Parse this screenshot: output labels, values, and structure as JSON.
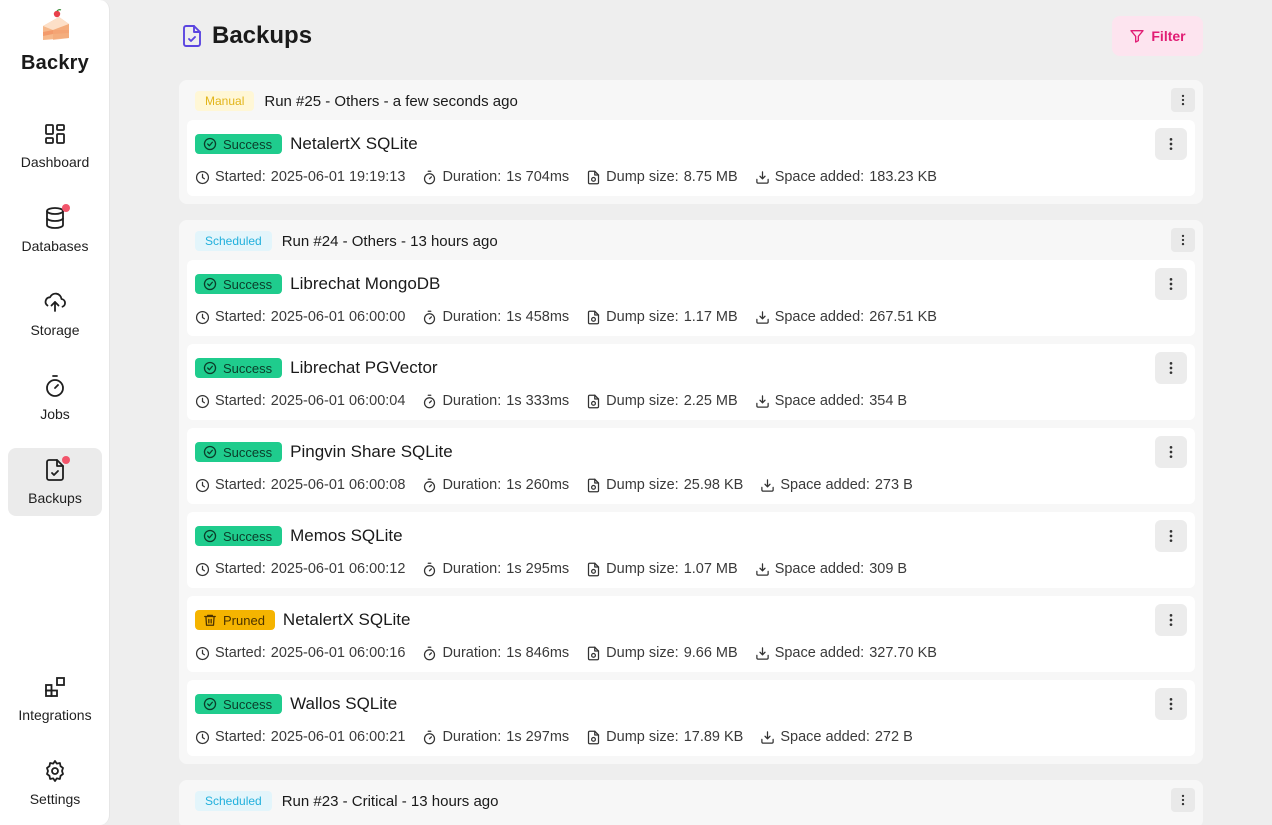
{
  "app": {
    "brand_name": "Backry",
    "accent": "#e11d74"
  },
  "sidebar": {
    "items": [
      {
        "label": "Dashboard",
        "icon": "dashboard-grid-icon"
      },
      {
        "label": "Databases",
        "icon": "database-icon",
        "notification": true
      },
      {
        "label": "Storage",
        "icon": "cloud-upload-icon"
      },
      {
        "label": "Jobs",
        "icon": "stopwatch-icon"
      },
      {
        "label": "Backups",
        "icon": "file-check-icon",
        "notification": true,
        "active": true
      },
      {
        "label": "Integrations",
        "icon": "blocks-icon"
      },
      {
        "label": "Settings",
        "icon": "gear-icon"
      }
    ]
  },
  "header": {
    "title": "Backups",
    "filter_label": "Filter"
  },
  "meta_labels": {
    "started": "Started:",
    "duration": "Duration:",
    "dump_size": "Dump size:",
    "space_added": "Space added:"
  },
  "runs": [
    {
      "tag": "Manual",
      "title": "Run #25 - Others - a few seconds ago",
      "items": [
        {
          "status": "Success",
          "name": "NetalertX SQLite",
          "started": "2025-06-01 19:19:13",
          "duration": "1s 704ms",
          "dump_size": "8.75 MB",
          "space_added": "183.23 KB"
        }
      ]
    },
    {
      "tag": "Scheduled",
      "title": "Run #24 - Others - 13 hours ago",
      "items": [
        {
          "status": "Success",
          "name": "Librechat MongoDB",
          "started": "2025-06-01 06:00:00",
          "duration": "1s 458ms",
          "dump_size": "1.17 MB",
          "space_added": "267.51 KB"
        },
        {
          "status": "Success",
          "name": "Librechat PGVector",
          "started": "2025-06-01 06:00:04",
          "duration": "1s 333ms",
          "dump_size": "2.25 MB",
          "space_added": "354 B"
        },
        {
          "status": "Success",
          "name": "Pingvin Share SQLite",
          "started": "2025-06-01 06:00:08",
          "duration": "1s 260ms",
          "dump_size": "25.98 KB",
          "space_added": "273 B"
        },
        {
          "status": "Success",
          "name": "Memos SQLite",
          "started": "2025-06-01 06:00:12",
          "duration": "1s 295ms",
          "dump_size": "1.07 MB",
          "space_added": "309 B"
        },
        {
          "status": "Pruned",
          "name": "NetalertX SQLite",
          "started": "2025-06-01 06:00:16",
          "duration": "1s 846ms",
          "dump_size": "9.66 MB",
          "space_added": "327.70 KB"
        },
        {
          "status": "Success",
          "name": "Wallos SQLite",
          "started": "2025-06-01 06:00:21",
          "duration": "1s 297ms",
          "dump_size": "17.89 KB",
          "space_added": "272 B"
        }
      ]
    },
    {
      "tag": "Scheduled",
      "title": "Run #23 - Critical - 13 hours ago",
      "items": []
    }
  ]
}
